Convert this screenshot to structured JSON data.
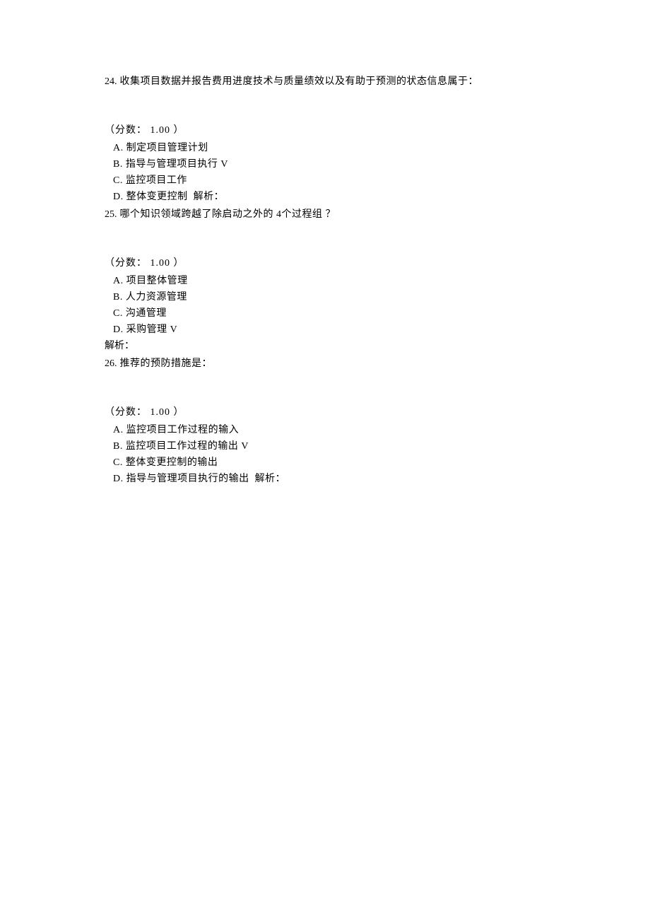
{
  "questions": [
    {
      "number": "24.",
      "text": "收集项目数据并报告费用进度技术与质量绩效以及有助于预测的状态信息属于：",
      "score_label": "（分数：",
      "score_value": "1.00",
      "score_suffix": "）",
      "options": [
        {
          "letter": "A.",
          "text": "制定项目管理计划",
          "mark": ""
        },
        {
          "letter": "B.",
          "text": "指导与管理项目执行",
          "mark": "V"
        },
        {
          "letter": "C.",
          "text": "监控项目工作",
          "mark": ""
        },
        {
          "letter": "D.",
          "text": "整体变更控制",
          "mark": "",
          "analysis": "解析："
        }
      ],
      "analysis_standalone": ""
    },
    {
      "number": "25.",
      "text": "哪个知识领域跨越了除启动之外的 4个过程组 ？",
      "score_label": "（分数：",
      "score_value": "1.00",
      "score_suffix": "）",
      "options": [
        {
          "letter": "A.",
          "text": "项目整体管理",
          "mark": ""
        },
        {
          "letter": "B.",
          "text": "人力资源管理",
          "mark": ""
        },
        {
          "letter": "C.",
          "text": "沟通管理",
          "mark": ""
        },
        {
          "letter": "D.",
          "text": "采购管理",
          "mark": "V"
        }
      ],
      "analysis_standalone": "解析："
    },
    {
      "number": "26.",
      "text": "推荐的预防措施是：",
      "score_label": "（分数：",
      "score_value": "1.00",
      "score_suffix": "）",
      "options": [
        {
          "letter": "A.",
          "text": "监控项目工作过程的输入",
          "mark": ""
        },
        {
          "letter": "B.",
          "text": "监控项目工作过程的输出",
          "mark": "V"
        },
        {
          "letter": "C.",
          "text": "整体变更控制的输出",
          "mark": ""
        },
        {
          "letter": "D.",
          "text": "指导与管理项目执行的输出",
          "mark": "",
          "analysis": "解析："
        }
      ],
      "analysis_standalone": ""
    }
  ]
}
